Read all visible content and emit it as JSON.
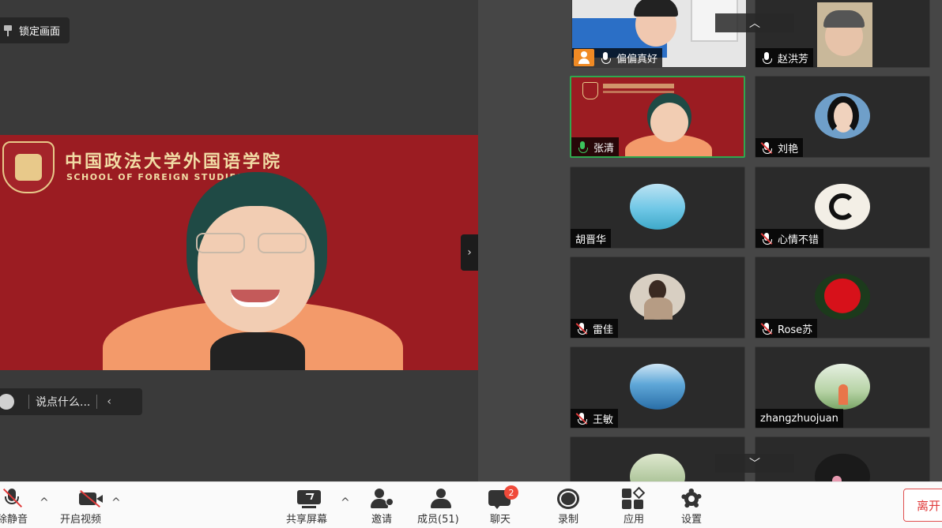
{
  "main": {
    "lock_label": "锁定画面",
    "school_name_cn": "中国政法大学外国语学院",
    "school_name_en": "SCHOOL OF FOREIGN STUDIES",
    "chat_placeholder": "说点什么...",
    "collapse_arrow": "›",
    "chat_arrow": "‹"
  },
  "gallery": {
    "scroll_up": "︿",
    "scroll_down": "﹀",
    "participants": [
      {
        "name": "偏偏真好",
        "mic": "on-white",
        "host": true
      },
      {
        "name": "赵洪芳",
        "mic": "on-white"
      },
      {
        "name": "张清",
        "mic": "on",
        "active": true
      },
      {
        "name": "刘艳",
        "mic": "muted"
      },
      {
        "name": "胡晋华",
        "mic": "none"
      },
      {
        "name": "心情不错",
        "mic": "muted"
      },
      {
        "name": "雷佳",
        "mic": "muted"
      },
      {
        "name": "Rose苏",
        "mic": "muted"
      },
      {
        "name": "王敏",
        "mic": "muted"
      },
      {
        "name": "zhangzhuojuan",
        "mic": "none"
      }
    ]
  },
  "toolbar": {
    "unmute": "除静音",
    "start_video": "开启视频",
    "share_screen": "共享屏幕",
    "invite": "邀请",
    "members": "成员(51)",
    "chat": "聊天",
    "chat_badge": "2",
    "record": "录制",
    "apps": "应用",
    "settings": "设置",
    "leave": "离开",
    "caret": "^"
  },
  "colors": {
    "banner_red": "#9b1c22",
    "active_border": "#2fa84f",
    "leave_red": "#e03a3a",
    "host_orange": "#f08a24"
  }
}
